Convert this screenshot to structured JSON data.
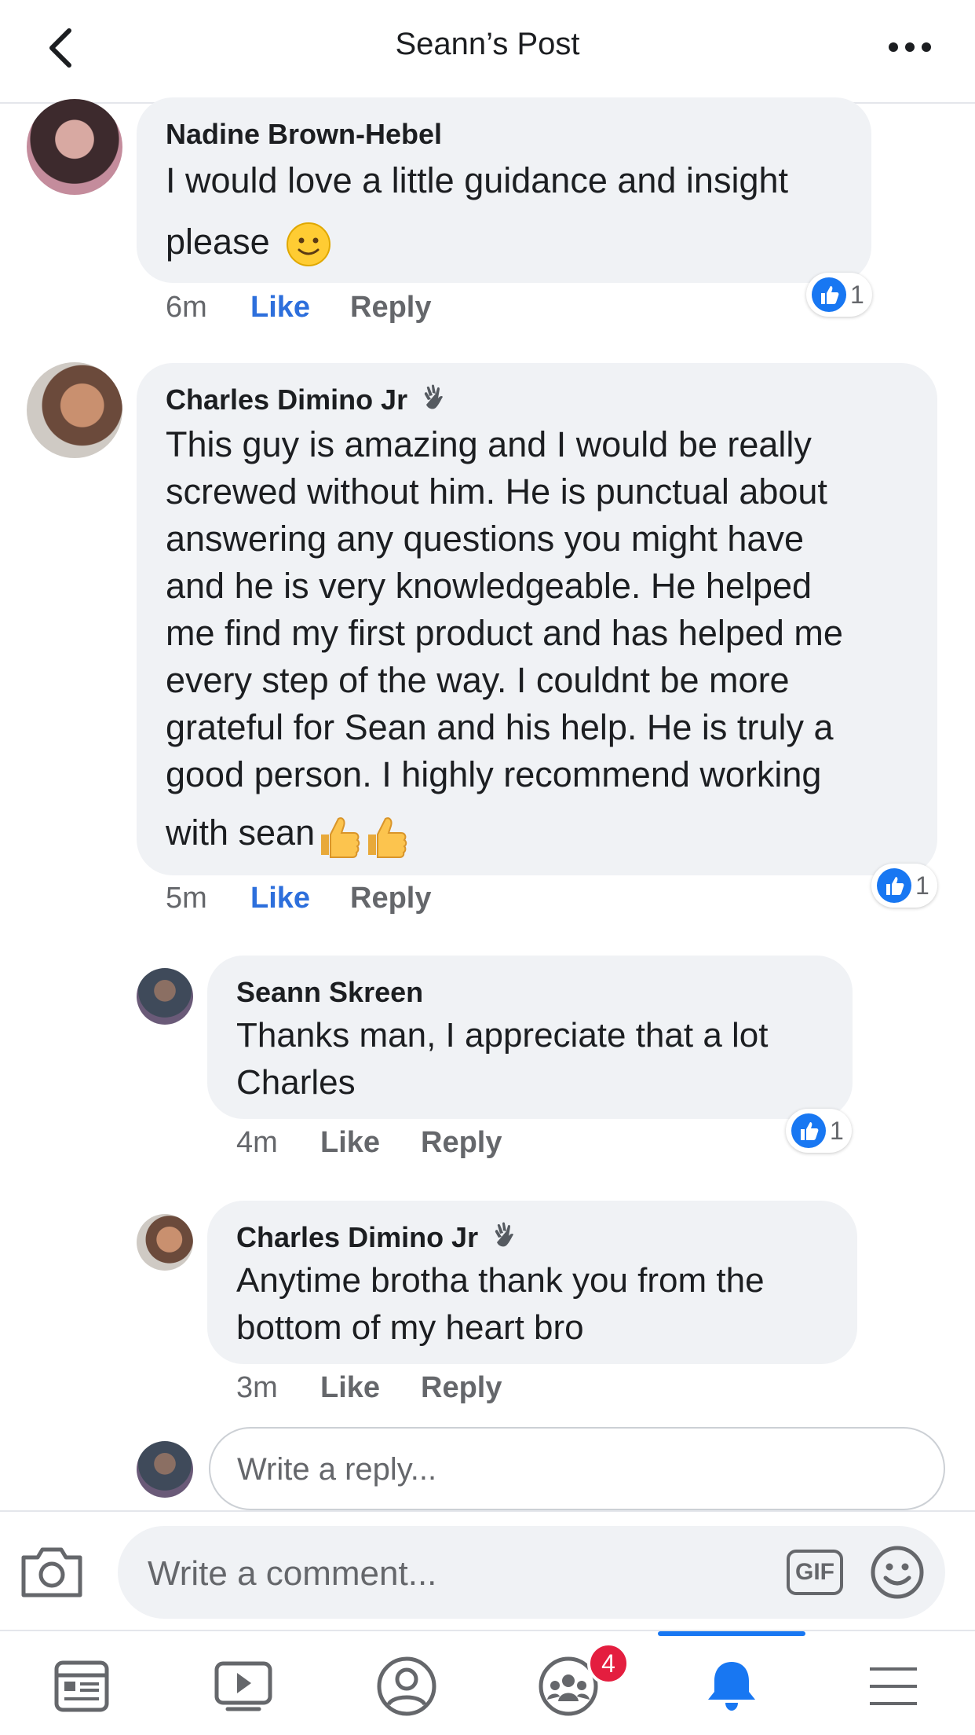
{
  "header": {
    "title": "Seann’s Post",
    "back_icon": "chevron-left-icon",
    "more_icon": "more-horizontal-icon"
  },
  "comments": [
    {
      "author": "Nadine Brown-Hebel",
      "text_line1": "I would love a little guidance and insight",
      "text_line2": "please",
      "emoji": "slightly-smiling-face",
      "time": "6m",
      "like_label": "Like",
      "reply_label": "Reply",
      "reaction_count": "1",
      "liked": true
    },
    {
      "author": "Charles Dimino Jr",
      "author_badge": "waving-hand-icon",
      "lines": [
        "This guy is amazing and I would be really",
        "screwed without him. He is punctual about",
        "answering any questions you might have",
        "and he is very knowledgeable. He helped",
        "me find my first product and has helped me",
        "every step of the way. I couldnt be more",
        "grateful for Sean and his help. He is truly a",
        "good person. I highly recommend working",
        "with sean"
      ],
      "emoji": "thumbs-up x2",
      "time": "5m",
      "like_label": "Like",
      "reply_label": "Reply",
      "reaction_count": "1",
      "liked": true
    }
  ],
  "replies": [
    {
      "author": "Seann Skreen",
      "lines": [
        "Thanks man, I appreciate that a lot",
        "Charles"
      ],
      "time": "4m",
      "like_label": "Like",
      "reply_label": "Reply",
      "reaction_count": "1"
    },
    {
      "author": "Charles Dimino Jr",
      "author_badge": "waving-hand-icon",
      "lines": [
        "Anytime brotha thank you from the",
        "bottom of my heart bro"
      ],
      "time": "3m",
      "like_label": "Like",
      "reply_label": "Reply"
    }
  ],
  "reply_input": {
    "placeholder": "Write a reply..."
  },
  "composer": {
    "placeholder": "Write a comment...",
    "gif_label": "GIF",
    "camera_icon": "camera-icon",
    "emoji_icon": "smiley-icon"
  },
  "tabbar": {
    "tabs": [
      "news-feed-icon",
      "watch-icon",
      "profile-icon",
      "groups-icon",
      "notifications-icon",
      "menu-icon"
    ],
    "groups_badge": "4",
    "active_tab": "notifications-icon"
  },
  "colors": {
    "accent": "#1877f2",
    "like_blue": "#2d6fdc",
    "bubble": "#f0f2f5",
    "meta_gray": "#65676b",
    "badge_red": "#e41e3f"
  }
}
